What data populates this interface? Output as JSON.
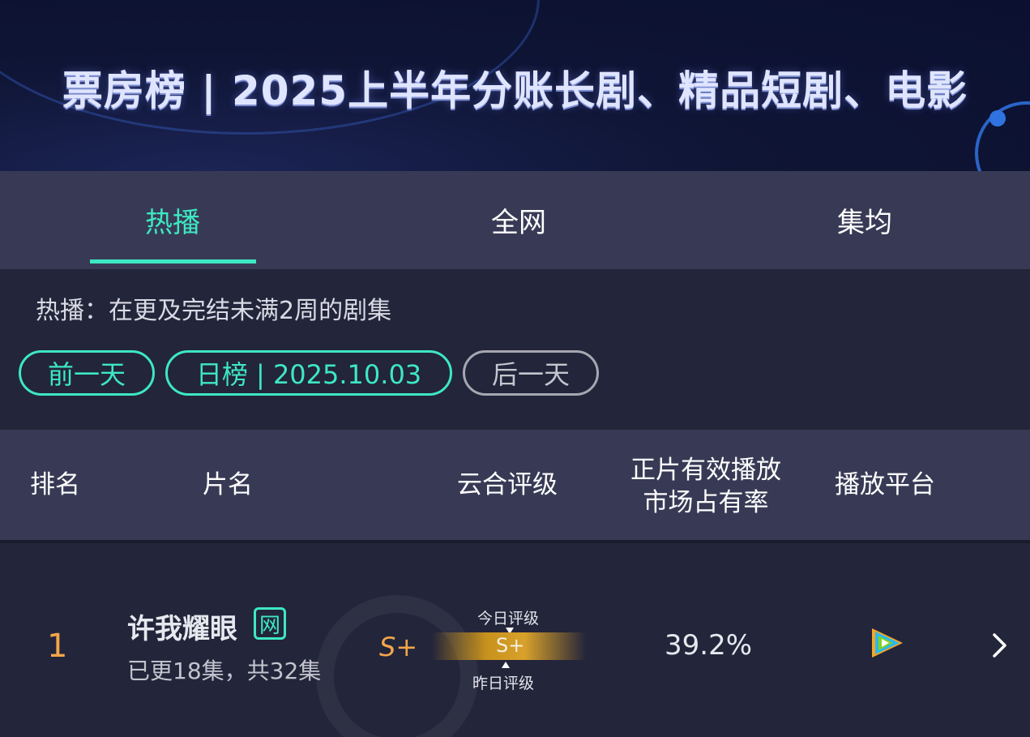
{
  "banner": {
    "title": "票房榜 | 2025上半年分账长剧、精品短剧、电影"
  },
  "tabs": [
    {
      "label": "热播",
      "active": true
    },
    {
      "label": "全网",
      "active": false
    },
    {
      "label": "集均",
      "active": false
    }
  ],
  "filter": {
    "description": "热播：在更及完结未满2周的剧集",
    "prev_day": "前一天",
    "date_label": "日榜 | 2025.10.03",
    "next_day": "后一天"
  },
  "table": {
    "headers": {
      "rank": "排名",
      "title": "片名",
      "rating": "云合评级",
      "share_line1": "正片有效播放",
      "share_line2": "市场占有率",
      "platform": "播放平台"
    },
    "rows": [
      {
        "rank": "1",
        "title": "许我耀眼",
        "badge": "网",
        "episodes": "已更18集，共32集",
        "grade": "S+",
        "grade_bar": "S+",
        "today_label": "今日评级",
        "yesterday_label": "昨日评级",
        "share": "39.2%",
        "platform_icon": "tencent-video-icon"
      }
    ]
  },
  "colors": {
    "accent": "#3de8c2",
    "rank": "#f3a64a",
    "grade_bar": "#d9a12a",
    "header_bg": "#383a55",
    "body_bg": "#23253a"
  }
}
